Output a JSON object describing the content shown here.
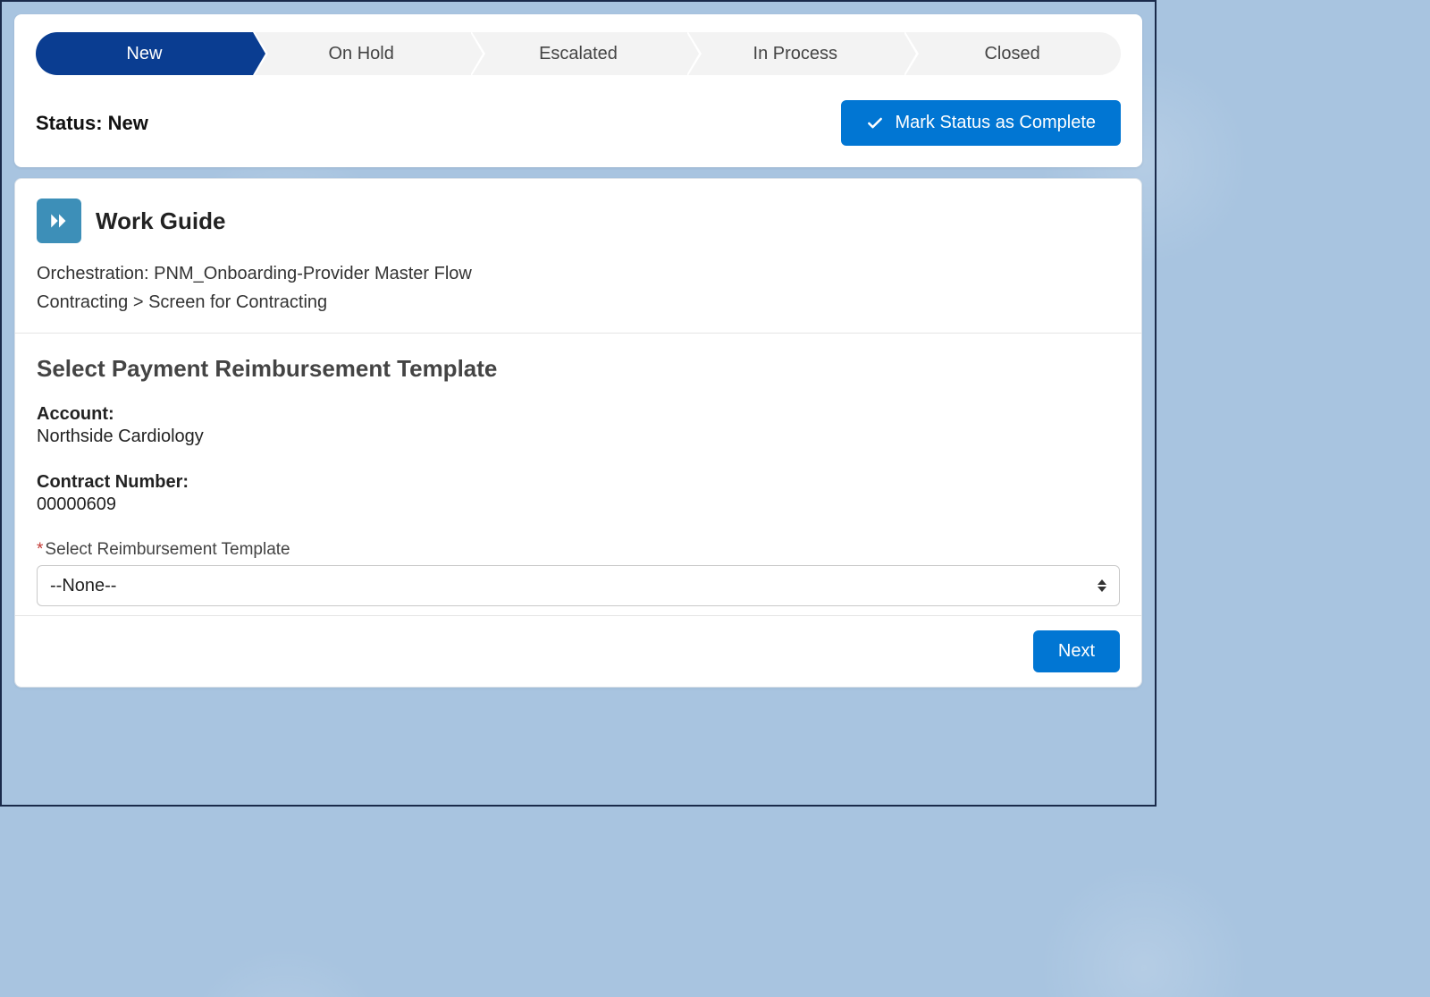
{
  "path": {
    "steps": [
      {
        "label": "New",
        "active": true
      },
      {
        "label": "On Hold",
        "active": false
      },
      {
        "label": "Escalated",
        "active": false
      },
      {
        "label": "In Process",
        "active": false
      },
      {
        "label": "Closed",
        "active": false
      }
    ]
  },
  "status": {
    "text": "Status: New",
    "mark_complete_label": "Mark Status as Complete"
  },
  "work_guide": {
    "title": "Work Guide",
    "orchestration_line": "Orchestration: PNM_Onboarding-Provider Master Flow",
    "breadcrumb_line": "Contracting > Screen for Contracting",
    "section_title": "Select Payment Reimbursement Template",
    "account_label": "Account:",
    "account_value": "Northside Cardiology",
    "contract_label": "Contract Number:",
    "contract_value": "00000609",
    "select_label": "Select Reimbursement Template",
    "select_value": "--None--",
    "next_label": "Next"
  }
}
